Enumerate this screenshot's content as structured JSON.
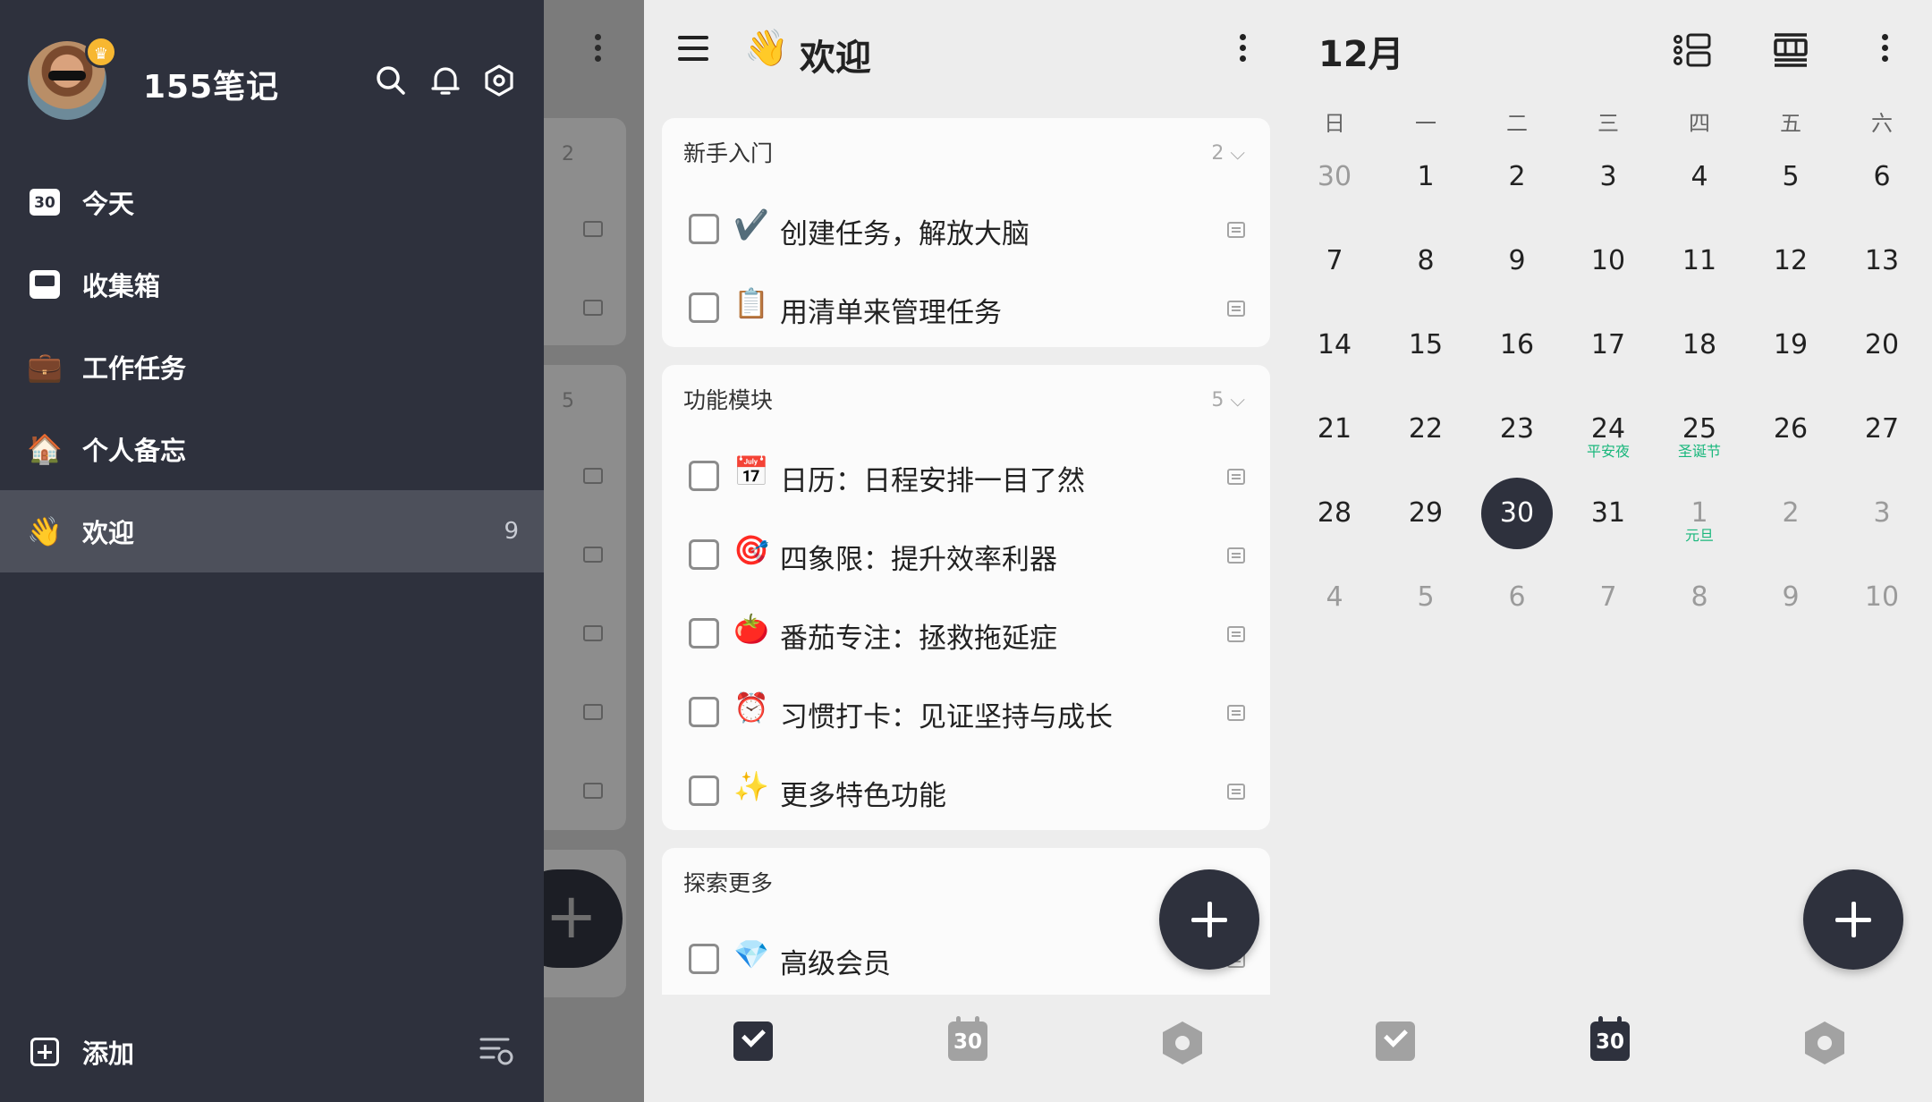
{
  "drawer": {
    "app_title": "155笔记",
    "items": [
      {
        "label": "今天",
        "icon": "calendar-today-icon",
        "cal_num": "30"
      },
      {
        "label": "收集箱",
        "icon": "inbox-icon"
      },
      {
        "label": "工作任务",
        "icon": "briefcase-icon",
        "emoji": "💼"
      },
      {
        "label": "个人备忘",
        "icon": "house-icon",
        "emoji": "🏠"
      },
      {
        "label": "欢迎",
        "icon": "waving-hand-icon",
        "emoji": "👋",
        "count": "9"
      }
    ],
    "footer": {
      "add_label": "添加"
    }
  },
  "strip": {
    "count_1": "2",
    "count_2": "5"
  },
  "list": {
    "title_emoji": "👋",
    "title": "欢迎",
    "sections": [
      {
        "title": "新手入门",
        "count": "2",
        "tasks": [
          {
            "emoji": "✔️",
            "text": "创建任务，解放大脑"
          },
          {
            "emoji": "📋",
            "text": "用清单来管理任务"
          }
        ]
      },
      {
        "title": "功能模块",
        "count": "5",
        "tasks": [
          {
            "emoji": "📅",
            "text": "日历：日程安排一目了然"
          },
          {
            "emoji": "🎯",
            "text": "四象限：提升效率利器"
          },
          {
            "emoji": "🍅",
            "text": "番茄专注：拯救拖延症"
          },
          {
            "emoji": "⏰",
            "text": "习惯打卡：见证坚持与成长"
          },
          {
            "emoji": "✨",
            "text": "更多特色功能"
          }
        ]
      },
      {
        "title": "探索更多",
        "tasks": [
          {
            "emoji": "💎",
            "text": "高级会员"
          }
        ]
      }
    ],
    "nav": {
      "calendar_num": "30"
    }
  },
  "calendar": {
    "month": "12月",
    "weekdays": [
      "日",
      "一",
      "二",
      "三",
      "四",
      "五",
      "六"
    ],
    "weeks": [
      [
        "30",
        "1",
        "2",
        "3",
        "4",
        "5",
        "6"
      ],
      [
        "7",
        "8",
        "9",
        "10",
        "11",
        "12",
        "13"
      ],
      [
        "14",
        "15",
        "16",
        "17",
        "18",
        "19",
        "20"
      ],
      [
        "21",
        "22",
        "23",
        "24",
        "25",
        "26",
        "27"
      ],
      [
        "28",
        "29",
        "30",
        "31",
        "1",
        "2",
        "3"
      ],
      [
        "4",
        "5",
        "6",
        "7",
        "8",
        "9",
        "10"
      ]
    ],
    "holidays": {
      "24": "平安夜",
      "25": "圣诞节",
      "jan1": "元旦"
    },
    "nav": {
      "calendar_num": "30"
    }
  },
  "colors": {
    "drawer_bg": "#2e313d",
    "accent": "#2e313d",
    "holiday_green": "#19b77c",
    "crown": "#f7b731"
  }
}
